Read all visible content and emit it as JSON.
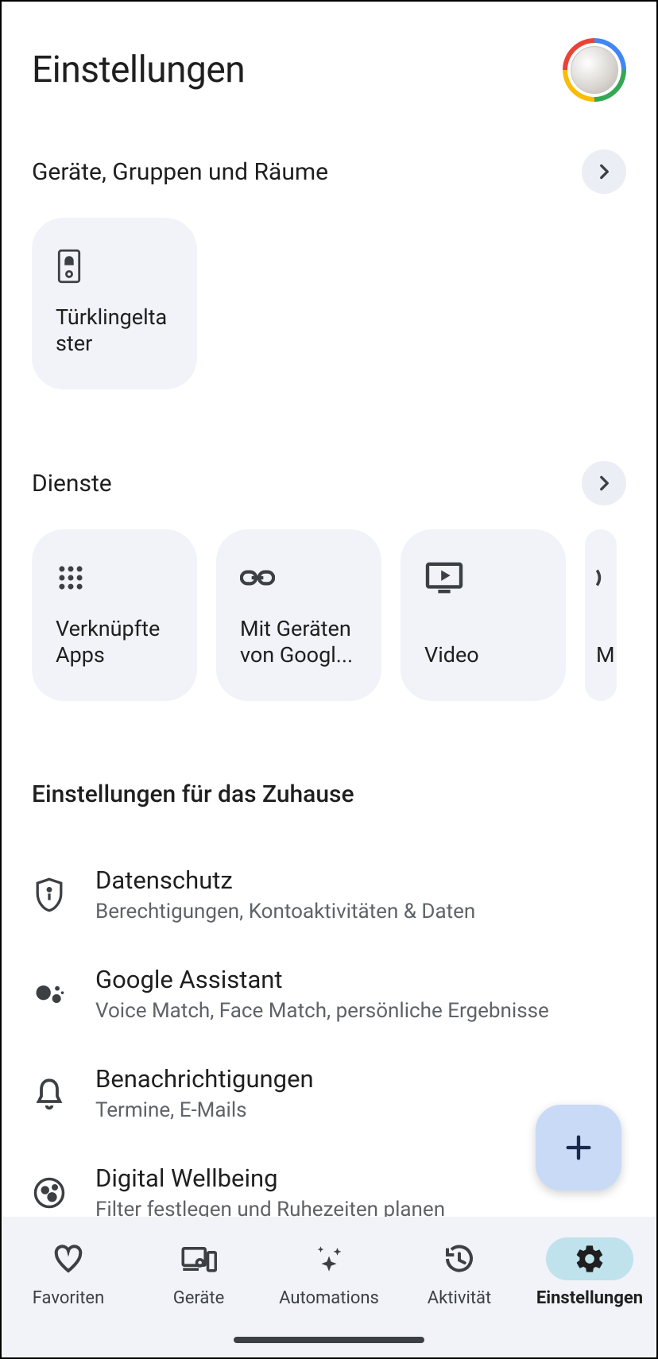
{
  "header": {
    "title": "Einstellungen"
  },
  "section_devices": {
    "title": "Geräte, Gruppen und Räume",
    "cards": [
      {
        "label": "Türklingelta ster"
      }
    ]
  },
  "section_services": {
    "title": "Dienste",
    "cards": [
      {
        "label": "Verknüpfte Apps"
      },
      {
        "label": "Mit Geräten von Googl..."
      },
      {
        "label": "Video"
      },
      {
        "label": "M"
      }
    ]
  },
  "section_home": {
    "title": "Einstellungen für das Zuhause",
    "items": [
      {
        "title": "Datenschutz",
        "subtitle": "Berechtigungen, Kontoaktivitäten & Daten"
      },
      {
        "title": "Google Assistant",
        "subtitle": "Voice Match, Face Match, persönliche Ergebnisse"
      },
      {
        "title": "Benachrichtigungen",
        "subtitle": "Termine, E-Mails"
      },
      {
        "title": "Digital Wellbeing",
        "subtitle": "Filter festlegen und Ruhezeiten planen"
      }
    ]
  },
  "nav": {
    "items": [
      {
        "label": "Favoriten"
      },
      {
        "label": "Geräte"
      },
      {
        "label": "Automations"
      },
      {
        "label": "Aktivität"
      },
      {
        "label": "Einstellungen"
      }
    ],
    "active_index": 4
  }
}
